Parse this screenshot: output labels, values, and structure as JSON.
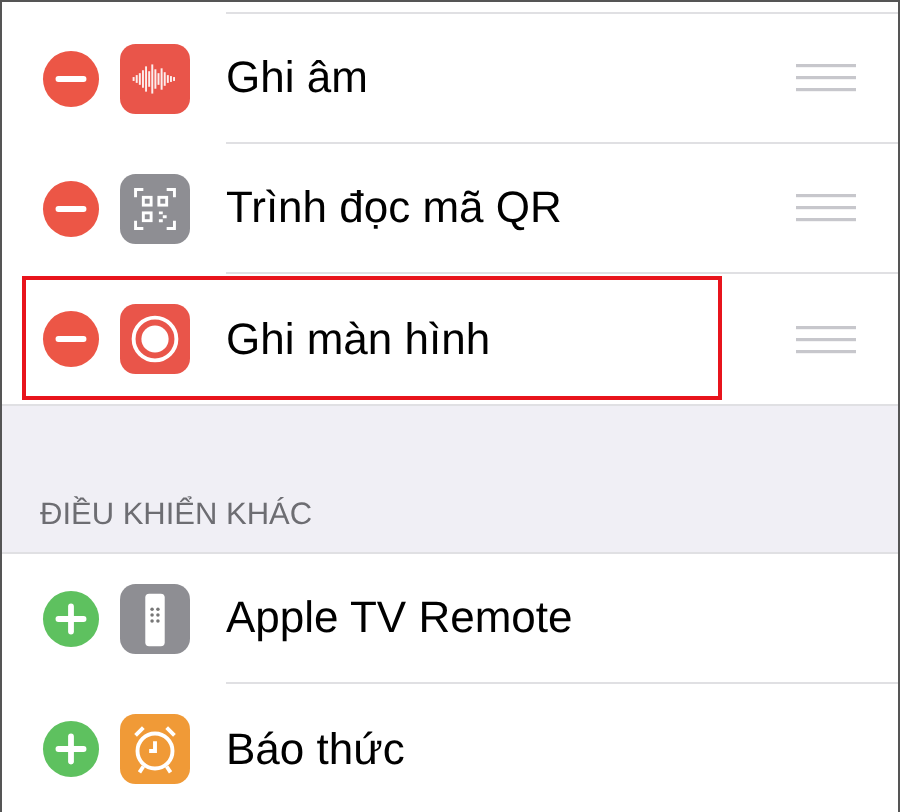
{
  "sections": [
    {
      "kind": "included",
      "rows": [
        {
          "label": "Ghi âm",
          "color": "#e9554a",
          "highlighted": false
        },
        {
          "label": "Trình đọc mã QR",
          "color": "#8e8e93",
          "highlighted": false
        },
        {
          "label": "Ghi màn hình",
          "color": "#e9554a",
          "highlighted": true
        }
      ]
    },
    {
      "kind": "more",
      "header": "ĐIỀU KHIỂN KHÁC",
      "rows": [
        {
          "label": "Apple TV Remote",
          "color": "#8e8e93",
          "highlighted": false
        },
        {
          "label": "Báo thức",
          "color": "#f09a37",
          "highlighted": false
        }
      ]
    }
  ]
}
